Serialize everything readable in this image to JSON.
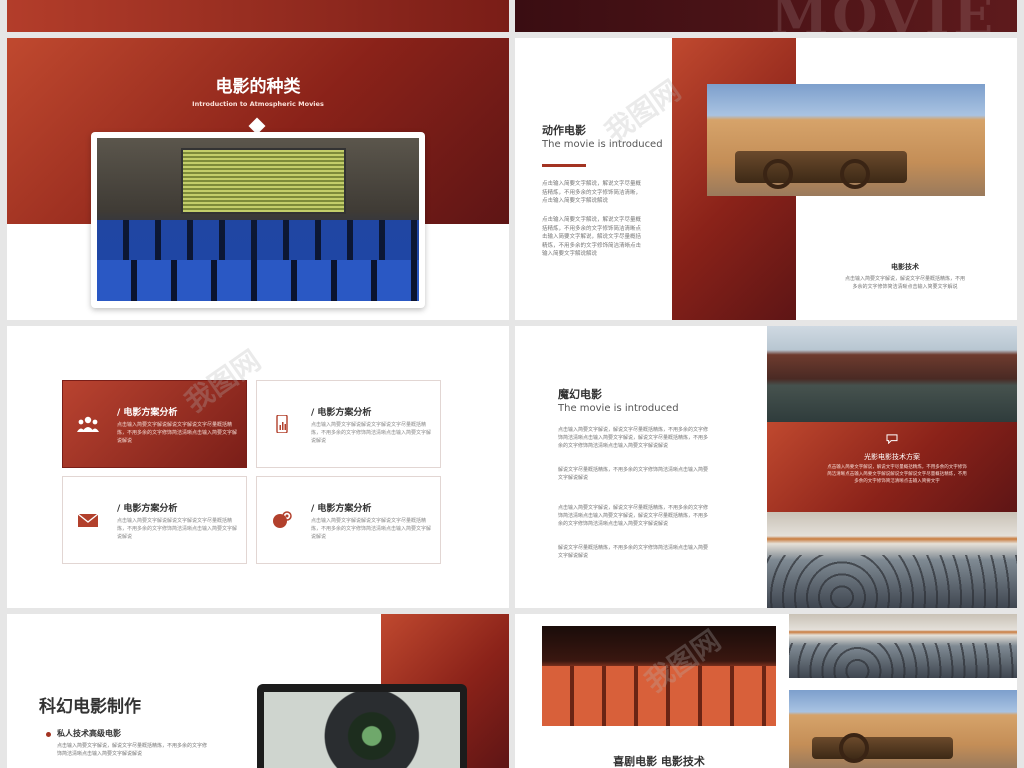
{
  "colors": {
    "accent": "#a33322",
    "accent_dark": "#5e1515",
    "page_bg": "#e6e6e6"
  },
  "top_right": {
    "watermark_word": "MOVIE"
  },
  "slide_types": {
    "title": "电影的种类",
    "subtitle": "Introduction to Atmospheric Movies"
  },
  "slide_action": {
    "title": "动作电影",
    "subtitle": "The movie is introduced",
    "para1": "点击输入简要文字解说，解说文字尽量概括精炼，不用多余的文字修饰简洁清晰，点击输入简要文字解说解说",
    "para2": "点击输入简要文字解说，解说文字尽量概括精炼，不用多余的文字修饰简洁清晰点击输入简要文字解说，解说文字尽量概括精炼，不用多余的文字修饰简洁清晰点击输入简要文字解说解说",
    "tech_title": "电影技术",
    "tech_body": "点击输入简要文字解说，解说文字尽量概括精炼，不用多余的文字修饰简洁清晰点击输入简要文字解说"
  },
  "slide_cards": {
    "cards": [
      {
        "icon": "people-icon",
        "title": "/ 电影方案分析",
        "body": "点击输入简要文字解说解说文字解说文字尽量概括精炼，不用多余的文字修饰简洁清晰点击输入简要文字解说解说"
      },
      {
        "icon": "phone-chart-icon",
        "title": "/ 电影方案分析",
        "body": "点击输入简要文字解说解说文字解说文字尽量概括精炼，不用多余的文字修饰简洁清晰点击输入简要文字解说解说"
      },
      {
        "icon": "mail-icon",
        "title": "/ 电影方案分析",
        "body": "点击输入简要文字解说解说文字解说文字尽量概括精炼，不用多余的文字修饰简洁清晰点击输入简要文字解说解说"
      },
      {
        "icon": "globe-target-icon",
        "title": "/ 电影方案分析",
        "body": "点击输入简要文字解说解说文字解说文字尽量概括精炼，不用多余的文字修饰简洁清晰点击输入简要文字解说解说"
      }
    ]
  },
  "slide_magic": {
    "title": "魔幻电影",
    "subtitle": "The movie is introduced",
    "para1": "点击输入简要文字解说，解说文字尽量概括精炼，不用多余的文字修饰简洁清晰点击输入简要文字解说，解说文字尽量概括精炼，不用多余的文字修饰简洁清晰点击输入简要文字解说解说",
    "para2": "解说文字尽量概括精炼，不用多余的文字修饰简洁清晰点击输入简要文字解说解说",
    "para3": "点击输入简要文字解说，解说文字尽量概括精炼，不用多余的文字修饰简洁清晰点击输入简要文字解说，解说文字尽量概括精炼，不用多余的文字修饰简洁清晰点击输入简要文字解说解说",
    "para4": "解说文字尽量概括精炼，不用多余的文字修饰简洁清晰点击输入简要文字解说解说",
    "box_title": "光影电影技术方案",
    "box_body": "点击输入简要文字解说，解说文字尽量概括精炼，不用多余的文字修饰简洁清晰点击输入简要文字解说解说文字解说文字尽量概括精炼，不用多余的文字修饰简洁清晰点击输入简要文字"
  },
  "slide_scifi": {
    "title": "科幻电影制作",
    "bullet": "私人技术高级电影",
    "body": "点击输入简要文字解说，解说文字尽量概括精炼，不用多余的文字修饰简洁清晰点击输入简要文字解说解说"
  },
  "slide_comedy": {
    "title": "喜剧电影 电影技术"
  },
  "watermark": "我图网"
}
